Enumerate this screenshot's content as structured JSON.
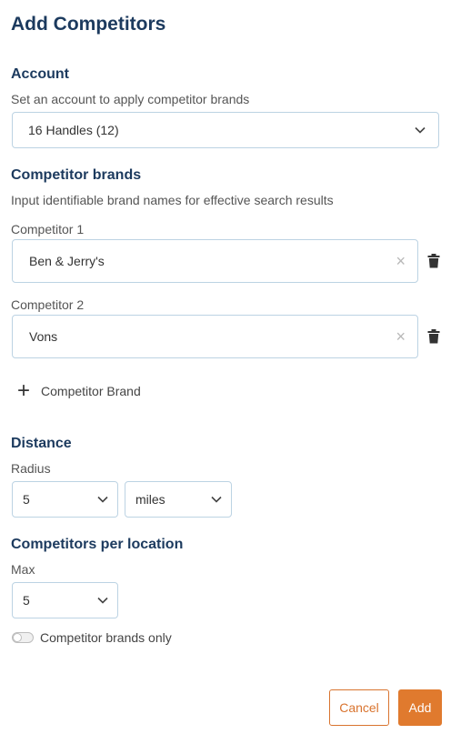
{
  "header": {
    "title": "Add Competitors"
  },
  "account": {
    "title": "Account",
    "description": "Set an account to apply competitor brands",
    "selected": "16 Handles (12)"
  },
  "competitors": {
    "title": "Competitor brands",
    "description": "Input identifiable brand names for effective search results",
    "items": [
      {
        "label": "Competitor 1",
        "value": "Ben & Jerry's"
      },
      {
        "label": "Competitor 2",
        "value": "Vons"
      }
    ],
    "add_label": "Competitor Brand"
  },
  "distance": {
    "title": "Distance",
    "radius_label": "Radius",
    "radius_value": "5",
    "unit_value": "miles"
  },
  "per_location": {
    "title": "Competitors per location",
    "max_label": "Max",
    "max_value": "5"
  },
  "toggle": {
    "label": "Competitor brands only",
    "on": false
  },
  "footer": {
    "cancel_label": "Cancel",
    "add_label": "Add"
  },
  "colors": {
    "heading": "#1c3a5e",
    "accent": "#e07a2e",
    "border": "#bcd3e3"
  }
}
